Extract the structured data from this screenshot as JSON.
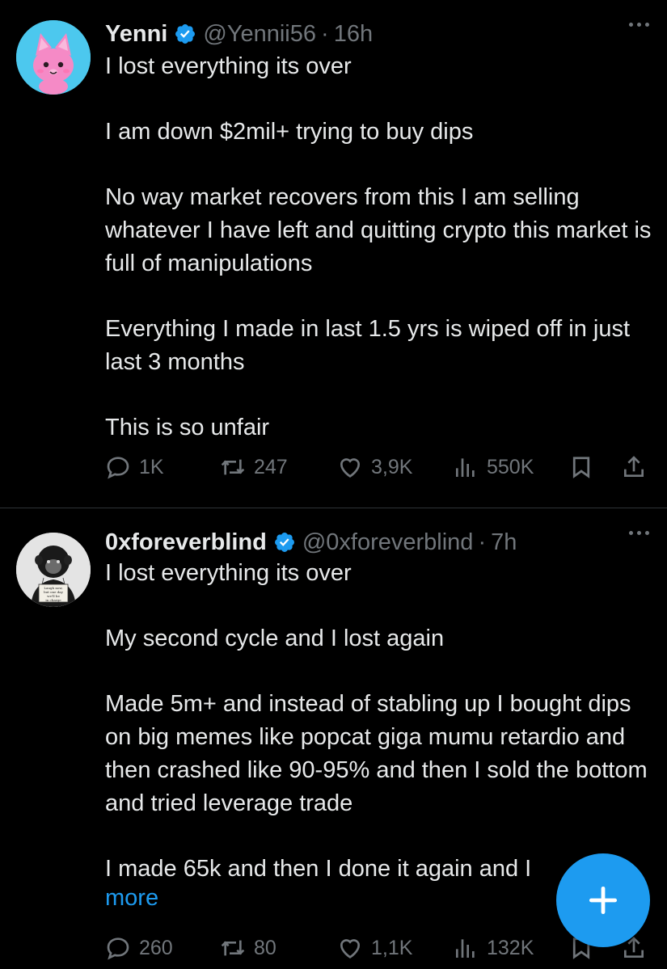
{
  "tweets": [
    {
      "name": "Yenni",
      "handle": "@Yennii56",
      "separator": "·",
      "time": "16h",
      "paragraphs": [
        "I lost everything its over",
        "I am down $2mil+ trying to buy dips",
        "No way market recovers from this I am selling whatever I have left and quitting crypto this market is full of manipulations",
        "Everything I made in last 1.5 yrs is wiped off in just last 3 months",
        "This is so unfair"
      ],
      "replies": "1K",
      "reposts": "247",
      "likes": "3,9K",
      "views": "550K"
    },
    {
      "name": "0xforeverblind",
      "handle": "@0xforeverblind",
      "separator": "·",
      "time": "7h",
      "paragraphs": [
        "I lost everything its over",
        "My second cycle and I lost again",
        "Made 5m+ and instead of stabling up I bought dips on big memes like popcat giga mumu retardio and then crashed like 90-95% and then I sold the bottom and tried leverage trade",
        "I made 65k and then I done it again and I"
      ],
      "show_more": "more",
      "replies": "260",
      "reposts": "80",
      "likes": "1,1K",
      "views": "132K"
    }
  ],
  "avatar2_text": "Laugh now, but one day we'll be in charge",
  "colors": {
    "background": "#000000",
    "text": "#e7e9ea",
    "muted": "#71767b",
    "accent": "#1d9bf0"
  },
  "icons": {
    "verified": "verified-badge-icon",
    "more": "more-options-icon",
    "reply": "reply-icon",
    "repost": "repost-icon",
    "like": "heart-icon",
    "views": "views-icon",
    "bookmark": "bookmark-icon",
    "share": "share-icon",
    "compose": "plus-icon"
  }
}
